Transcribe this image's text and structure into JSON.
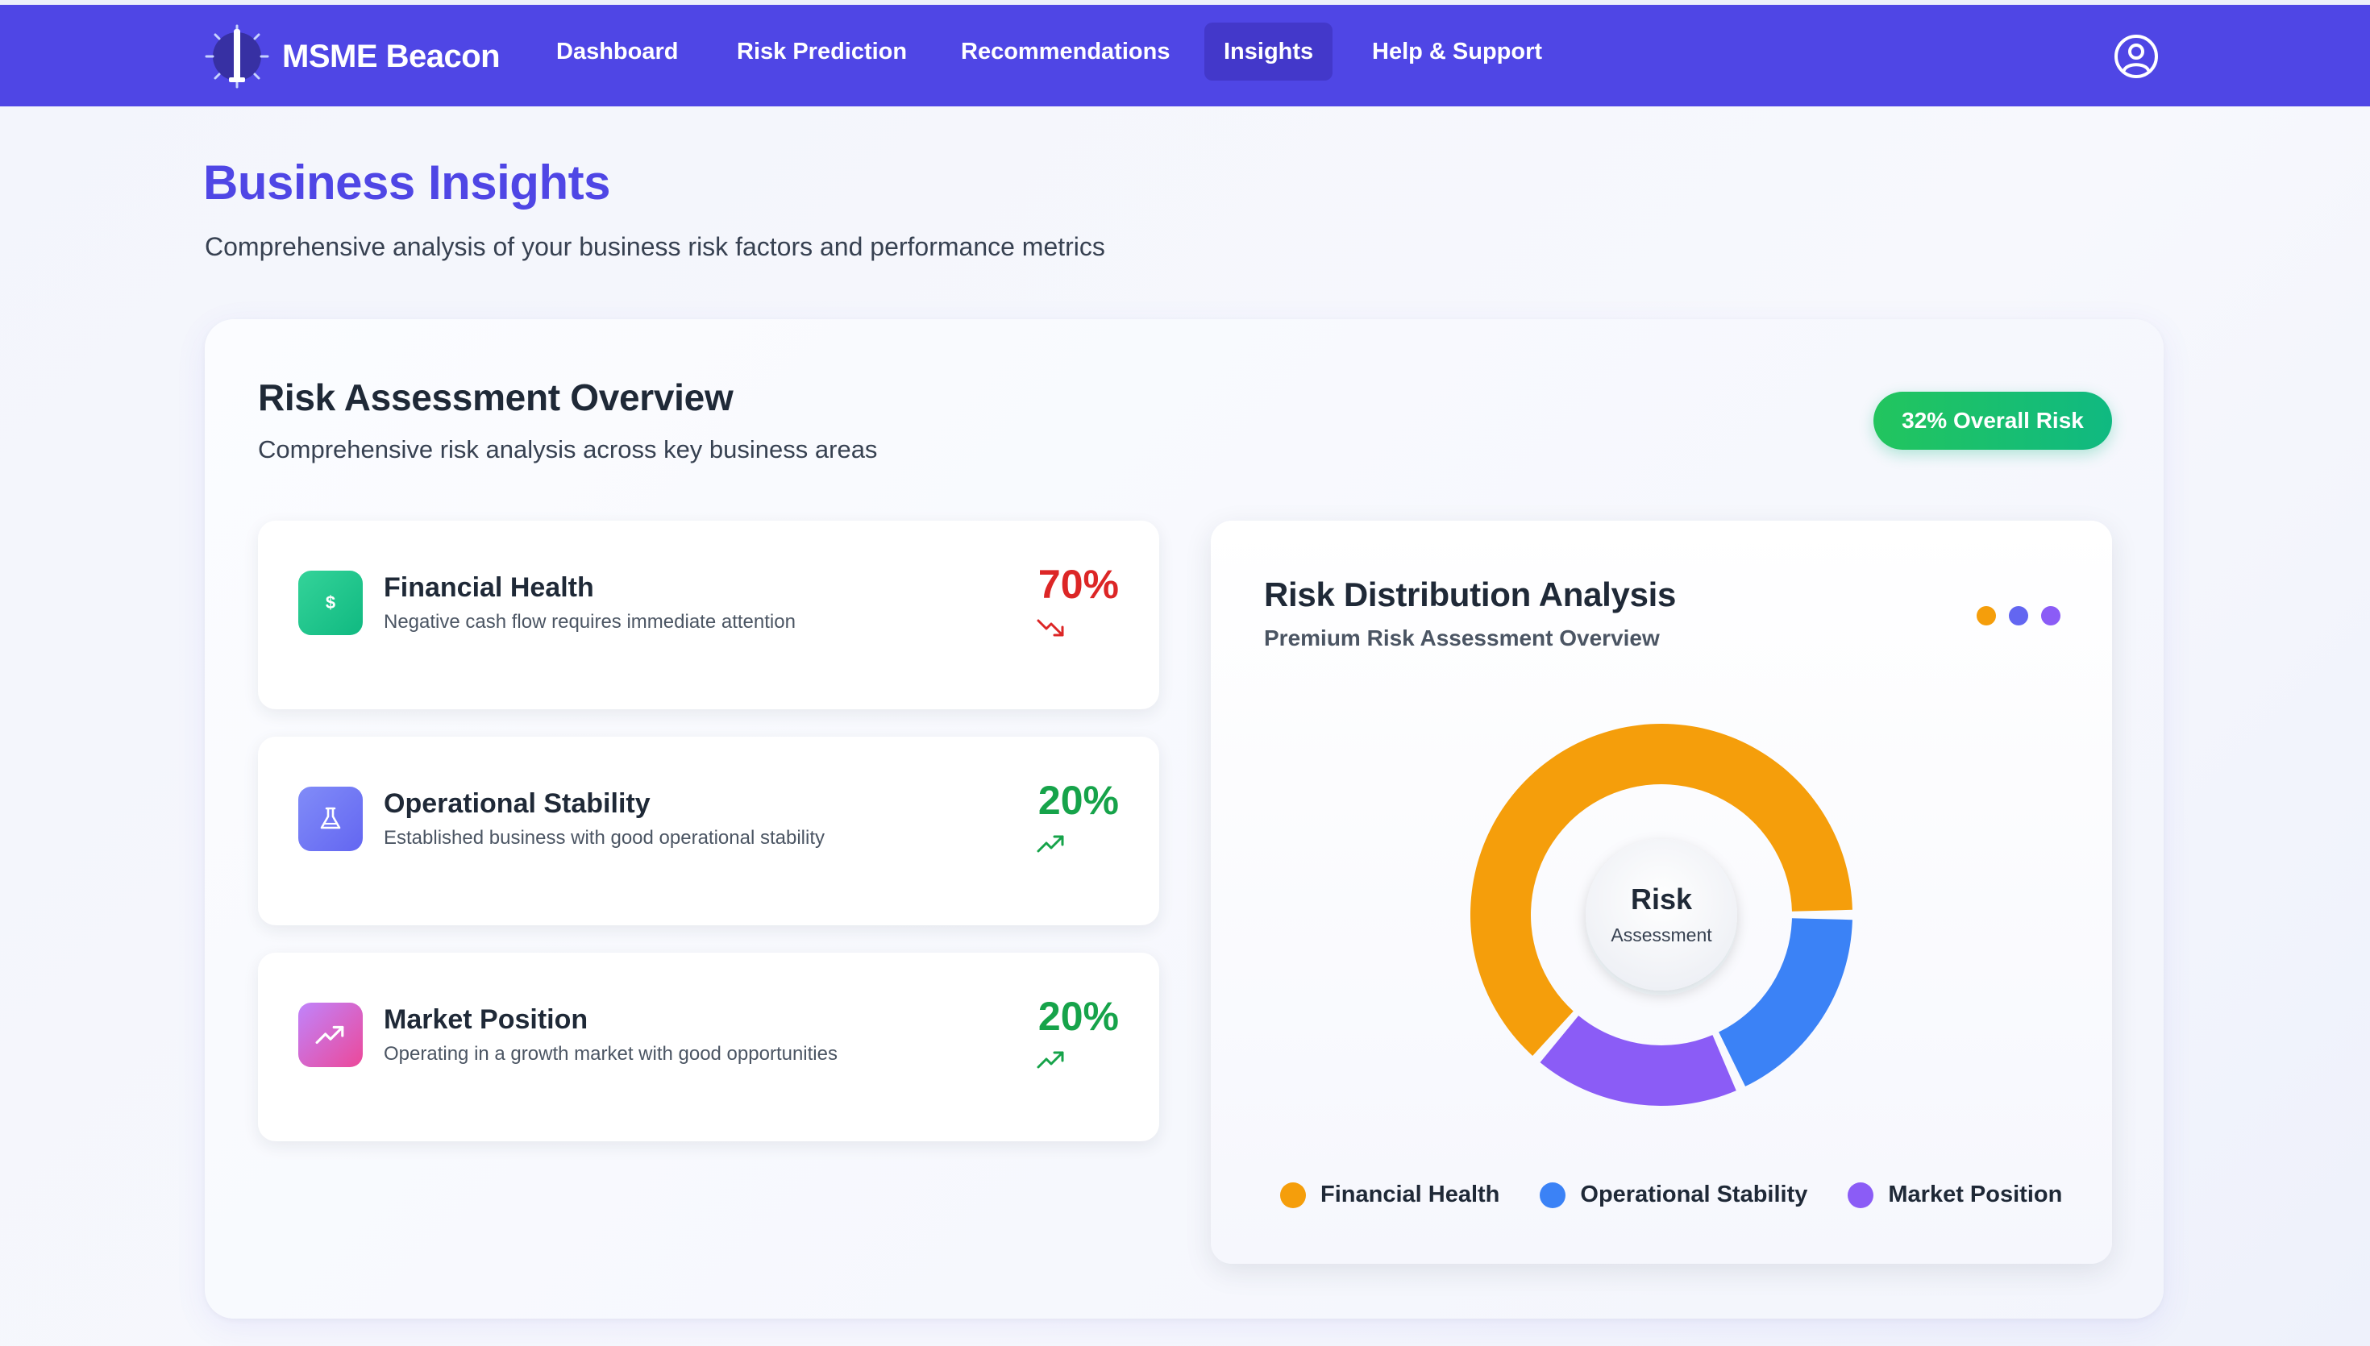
{
  "brand": {
    "name": "MSME Beacon"
  },
  "nav": {
    "items": [
      {
        "label": "Dashboard"
      },
      {
        "label": "Risk Prediction"
      },
      {
        "label": "Recommendations"
      },
      {
        "label": "Insights",
        "active": true
      },
      {
        "label": "Help & Support"
      }
    ]
  },
  "page": {
    "title": "Business Insights",
    "subtitle": "Comprehensive analysis of your business risk factors and performance metrics"
  },
  "overview": {
    "title": "Risk Assessment Overview",
    "subtitle": "Comprehensive risk analysis across key business areas",
    "badge": "32% Overall Risk",
    "metrics": [
      {
        "name": "Financial Health",
        "desc": "Negative cash flow requires immediate attention",
        "value": "70%",
        "trend": "down",
        "icon": "dollar-icon",
        "color": "#dc2626"
      },
      {
        "name": "Operational Stability",
        "desc": "Established business with good operational stability",
        "value": "20%",
        "trend": "up",
        "icon": "flask-icon",
        "color": "#16a34a"
      },
      {
        "name": "Market Position",
        "desc": "Operating in a growth market with good opportunities",
        "value": "20%",
        "trend": "up",
        "icon": "trending-up-icon",
        "color": "#16a34a"
      }
    ]
  },
  "distribution": {
    "title": "Risk Distribution Analysis",
    "subtitle": "Premium Risk Assessment Overview",
    "center_title": "Risk",
    "center_sub": "Assessment",
    "dot_colors": [
      "#f59e0b",
      "#6366f1",
      "#8b5cf6"
    ],
    "legend": [
      {
        "label": "Financial Health",
        "color": "#f59e0b"
      },
      {
        "label": "Operational Stability",
        "color": "#3b82f6"
      },
      {
        "label": "Market Position",
        "color": "#8b5cf6"
      }
    ]
  },
  "chart_data": {
    "type": "pie",
    "title": "Risk Distribution Analysis",
    "categories": [
      "Financial Health",
      "Operational Stability",
      "Market Position"
    ],
    "values": [
      70,
      20,
      20
    ],
    "colors": [
      "#f59e0b",
      "#3b82f6",
      "#8b5cf6"
    ],
    "legend": "bottom"
  }
}
